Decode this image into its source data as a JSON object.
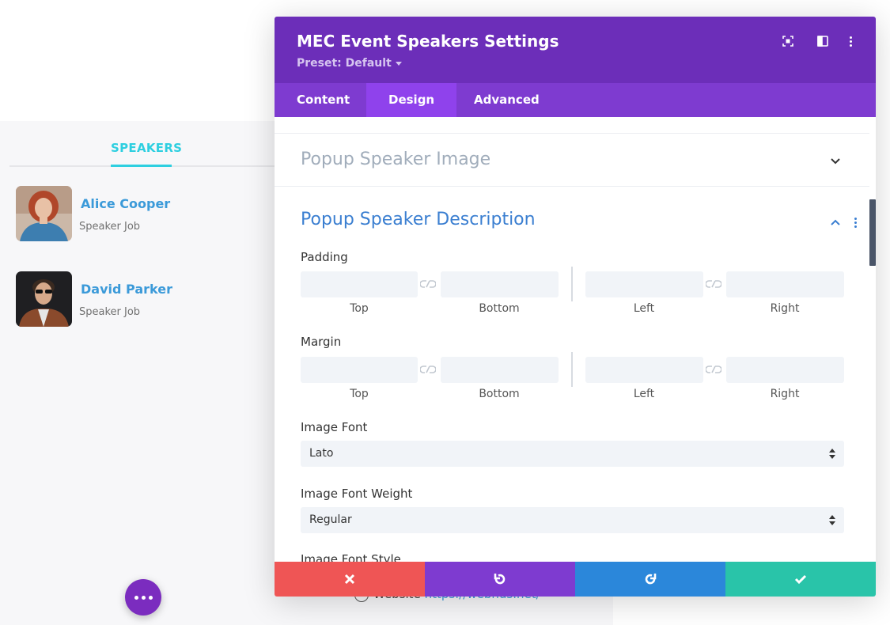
{
  "background": {
    "speakers_tab_label": "SPEAKERS",
    "speakers": [
      {
        "name": "Alice Cooper",
        "job": "Speaker Job"
      },
      {
        "name": "David Parker",
        "job": "Speaker Job"
      }
    ],
    "website": {
      "label": "Website",
      "url": "https://webnus.net/"
    },
    "colors": {
      "accent": "#2ecfe0",
      "link": "#3b9ad9",
      "fab": "#7b2cbf"
    }
  },
  "modal": {
    "title": "MEC Event Speakers Settings",
    "preset": "Preset: Default",
    "tabs": [
      "Content",
      "Design",
      "Advanced"
    ],
    "active_tab": "Design",
    "sections": {
      "collapsed_title": "Popup Speaker Image",
      "open_title": "Popup Speaker Description"
    },
    "padding": {
      "label": "Padding",
      "sides": [
        "Top",
        "Bottom",
        "Left",
        "Right"
      ]
    },
    "margin": {
      "label": "Margin",
      "sides": [
        "Top",
        "Bottom",
        "Left",
        "Right"
      ]
    },
    "image_font": {
      "label": "Image Font",
      "value": "Lato"
    },
    "image_font_weight": {
      "label": "Image Font Weight",
      "value": "Regular"
    },
    "image_font_style": {
      "label": "Image Font Style"
    },
    "colors": {
      "header": "#6c2eb9",
      "tabs": "#7e3bd0",
      "active_tab": "#8f42ec",
      "cancel": "#ef5555",
      "undo": "#7e3bd0",
      "redo": "#2b87da",
      "save": "#29c4a9"
    }
  }
}
